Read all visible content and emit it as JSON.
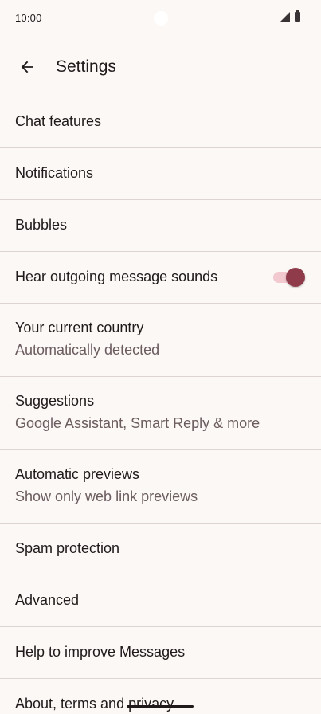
{
  "status_bar": {
    "time": "10:00"
  },
  "header": {
    "title": "Settings",
    "back_icon": "arrow-back-icon"
  },
  "settings": {
    "items": [
      {
        "title": "Chat features"
      },
      {
        "title": "Notifications"
      },
      {
        "title": "Bubbles"
      },
      {
        "title": "Hear outgoing message sounds",
        "toggle": true
      },
      {
        "title": "Your current country",
        "subtitle": "Automatically detected"
      },
      {
        "title": "Suggestions",
        "subtitle": "Google Assistant, Smart Reply & more"
      },
      {
        "title": "Automatic previews",
        "subtitle": "Show only web link previews"
      },
      {
        "title": "Spam protection"
      },
      {
        "title": "Advanced"
      },
      {
        "title": "Help to improve Messages"
      },
      {
        "title": "About, terms and privacy"
      }
    ]
  },
  "colors": {
    "background": "#fcf8f6",
    "accent": "#8f3b4a",
    "toggle_track": "#f2c9cf",
    "divider": "#ddd4d5"
  }
}
